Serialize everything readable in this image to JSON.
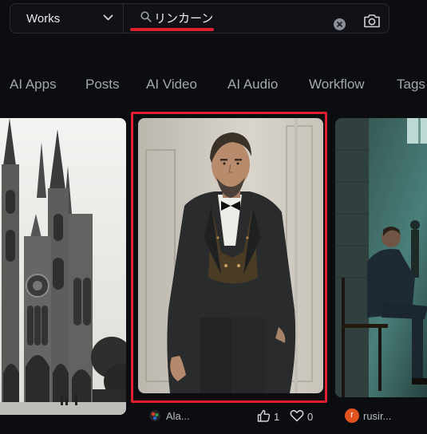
{
  "search": {
    "scope_label": "Works",
    "query": "リンカーン"
  },
  "nav": {
    "items": [
      "AI Apps",
      "Posts",
      "AI Video",
      "AI Audio",
      "Workflow",
      "Tags"
    ]
  },
  "cards": {
    "middle": {
      "author": "Ala...",
      "likes": "1",
      "favorites": "0"
    },
    "right": {
      "author": "rusir...",
      "avatar_letter": "r"
    }
  },
  "colors": {
    "background": "#0c0d11",
    "highlight_red": "#e0202e",
    "avatar_orange": "#e0531e"
  }
}
